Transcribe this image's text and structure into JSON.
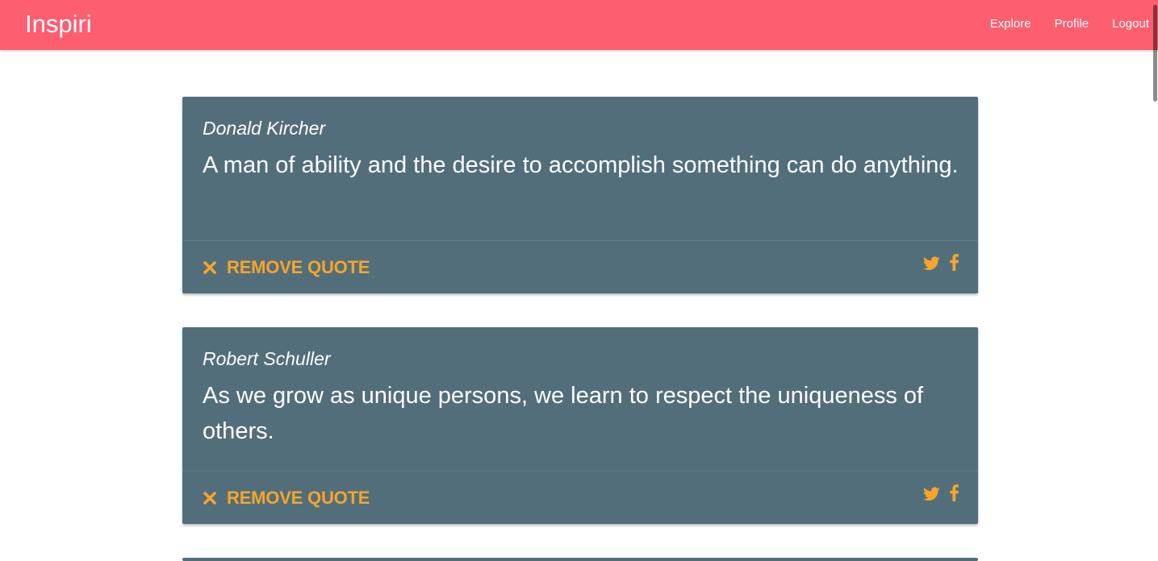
{
  "navbar": {
    "brand": "Inspiri",
    "links": [
      "Explore",
      "Profile",
      "Logout"
    ]
  },
  "colors": {
    "navbar_bg": "#fd5e70",
    "card_bg": "#526e7b",
    "accent": "#f7a52a"
  },
  "quotes": [
    {
      "author": "Donald Kircher",
      "text": "A man of ability and the desire to accomplish something can do anything.",
      "remove_label": "REMOVE QUOTE",
      "share_icons": [
        "twitter-icon",
        "facebook-icon"
      ]
    },
    {
      "author": "Robert Schuller",
      "text": "As we grow as unique persons, we learn to respect the uniqueness of others.",
      "remove_label": "REMOVE QUOTE",
      "share_icons": [
        "twitter-icon",
        "facebook-icon"
      ]
    }
  ]
}
